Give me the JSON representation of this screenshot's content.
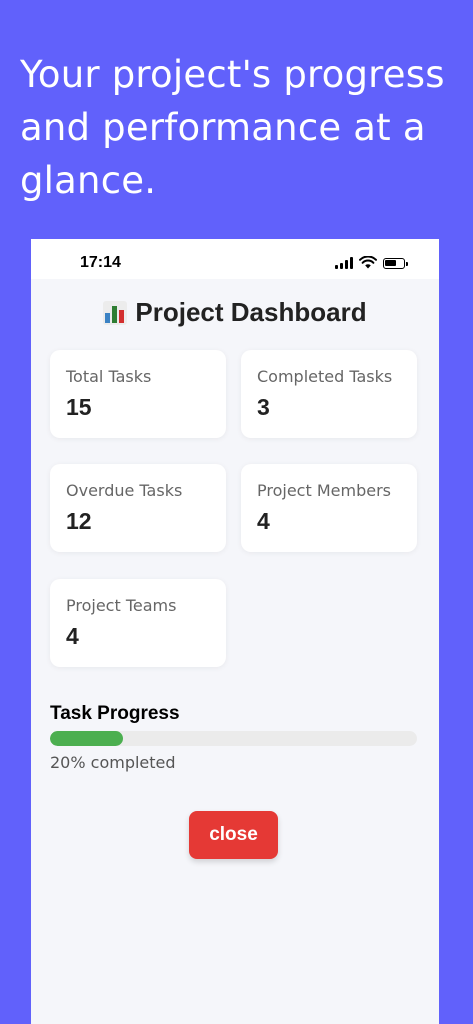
{
  "headline": "Your project's progress and performance at a glance.",
  "status_bar": {
    "time": "17:14"
  },
  "dashboard": {
    "title": "Project Dashboard",
    "title_icon": "bar-chart-icon"
  },
  "stats": [
    {
      "label": "Total Tasks",
      "value": "15"
    },
    {
      "label": "Completed Tasks",
      "value": "3"
    },
    {
      "label": "Overdue Tasks",
      "value": "12"
    },
    {
      "label": "Project Members",
      "value": "4"
    },
    {
      "label": "Project Teams",
      "value": "4"
    }
  ],
  "progress": {
    "title": "Task Progress",
    "percent": 20,
    "text": "20% completed",
    "fill_color": "#4caf50",
    "track_color": "#ebebeb"
  },
  "close_label": "close",
  "colors": {
    "background": "#6161fb",
    "close_button": "#e53935"
  }
}
